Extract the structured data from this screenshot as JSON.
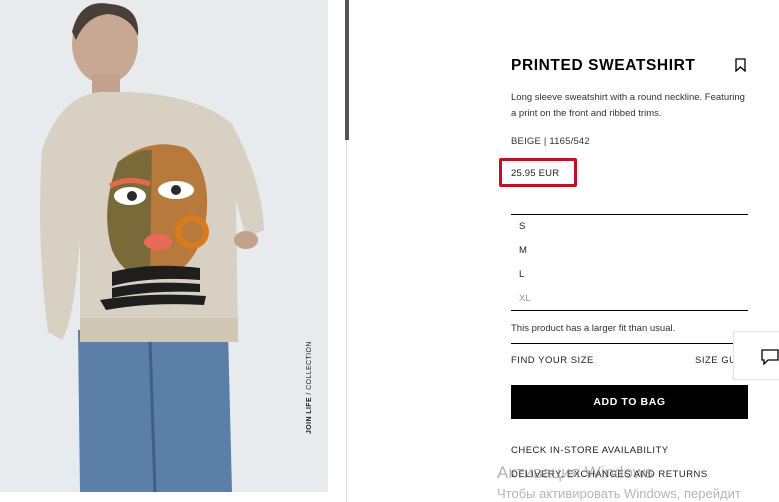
{
  "product": {
    "title": "PRINTED SWEATSHIRT",
    "description": "Long sleeve sweatshirt with a round neckline. Featuring a print on the front and ribbed trims.",
    "color_ref": "BEIGE | 1165/542",
    "price": "25.95 EUR",
    "highlight_color": "#c1121f",
    "image_tag_bold": "JOIN LIFE",
    "image_tag_rest": " / COLLECTION"
  },
  "sizes": [
    {
      "label": "S",
      "available": true
    },
    {
      "label": "M",
      "available": true
    },
    {
      "label": "L",
      "available": true
    },
    {
      "label": "XL",
      "available": false
    }
  ],
  "fit_note": "This product has a larger fit than usual.",
  "links": {
    "find_size": "FIND YOUR SIZE",
    "size_guide": "SIZE GUIDE",
    "check_store": "CHECK IN-STORE AVAILABILITY",
    "delivery": "DELIVERY, EXCHANGES AND RETURNS"
  },
  "buttons": {
    "add_to_bag": "ADD TO BAG"
  },
  "icons": {
    "bookmark": "bookmark-icon",
    "chat": "chat-icon"
  },
  "watermark": {
    "line1": "Активация Windows",
    "line2": "Чтобы активировать Windows, перейдит"
  }
}
